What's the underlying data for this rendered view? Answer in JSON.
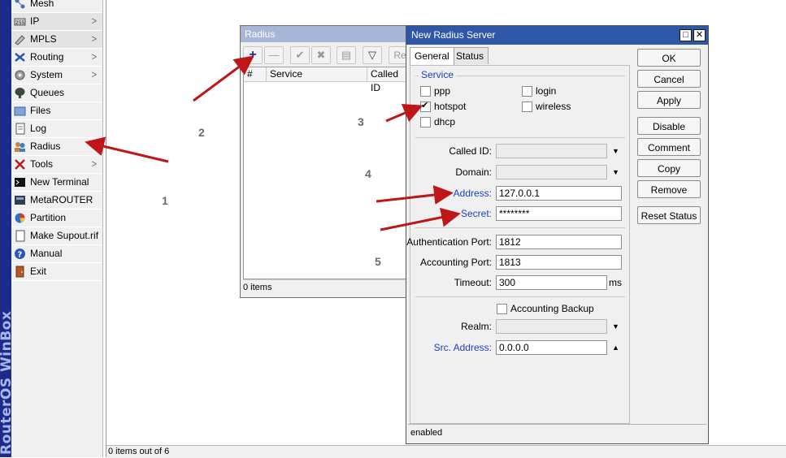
{
  "brand": {
    "text": "RouterOS WinBox"
  },
  "menu": {
    "items": [
      {
        "label": "Mesh",
        "icon": "mesh-icon",
        "arrow": false
      },
      {
        "label": "IP",
        "icon": "ip-icon",
        "arrow": true
      },
      {
        "label": "MPLS",
        "icon": "mpls-icon",
        "arrow": true
      },
      {
        "label": "Routing",
        "icon": "routing-icon",
        "arrow": true
      },
      {
        "label": "System",
        "icon": "gear-icon",
        "arrow": true
      },
      {
        "label": "Queues",
        "icon": "queues-icon",
        "arrow": false
      },
      {
        "label": "Files",
        "icon": "folder-icon",
        "arrow": false
      },
      {
        "label": "Log",
        "icon": "log-icon",
        "arrow": false
      },
      {
        "label": "Radius",
        "icon": "radius-users-icon",
        "arrow": false
      },
      {
        "label": "Tools",
        "icon": "tools-icon",
        "arrow": true
      },
      {
        "label": "New Terminal",
        "icon": "terminal-icon",
        "arrow": false
      },
      {
        "label": "MetaROUTER",
        "icon": "metarouter-icon",
        "arrow": false
      },
      {
        "label": "Partition",
        "icon": "pie-icon",
        "arrow": false
      },
      {
        "label": "Make Supout.rif",
        "icon": "document-icon",
        "arrow": false
      },
      {
        "label": "Manual",
        "icon": "help-icon",
        "arrow": false
      },
      {
        "label": "Exit",
        "icon": "exit-icon",
        "arrow": false
      }
    ],
    "arrow_glyph": "ᐳ"
  },
  "workspace": {
    "status": "0 items out of 6"
  },
  "radius_window": {
    "title": "Radius",
    "toolbar": {
      "add": "+",
      "remove": "—",
      "enable": "✔",
      "disable": "✖",
      "comment": "▤",
      "filter": "▽",
      "reset_partial": "Re"
    },
    "columns": [
      "#",
      "Service",
      "Called ID"
    ],
    "status": "0 items"
  },
  "dialog": {
    "title": "New Radius Server",
    "window_buttons": {
      "maximize": "□",
      "close": "✕"
    },
    "tabs": [
      "General",
      "Status"
    ],
    "service_section": {
      "title": "Service",
      "options": [
        {
          "label": "ppp",
          "checked": false
        },
        {
          "label": "login",
          "checked": false
        },
        {
          "label": "hotspot",
          "checked": true
        },
        {
          "label": "wireless",
          "checked": false
        },
        {
          "label": "dhcp",
          "checked": false
        }
      ]
    },
    "fields": {
      "called_id": {
        "label": "Called ID:",
        "value": ""
      },
      "domain": {
        "label": "Domain:",
        "value": ""
      },
      "address": {
        "label": "Address:",
        "value": "127.0.0.1"
      },
      "secret": {
        "label": "Secret:",
        "value": "********"
      },
      "auth_port": {
        "label": "Authentication Port:",
        "value": "1812"
      },
      "acct_port": {
        "label": "Accounting Port:",
        "value": "1813"
      },
      "timeout": {
        "label": "Timeout:",
        "value": "300",
        "unit": "ms"
      },
      "accounting_backup": {
        "label": "Accounting Backup",
        "checked": false
      },
      "realm": {
        "label": "Realm:",
        "value": ""
      },
      "src_address": {
        "label": "Src. Address:",
        "value": "0.0.0.0"
      }
    },
    "dropdown_glyph": "▼",
    "collapse_glyph": "▲",
    "buttons": [
      "OK",
      "Cancel",
      "Apply",
      "Disable",
      "Comment",
      "Copy",
      "Remove",
      "Reset Status"
    ],
    "status": "enabled"
  },
  "annotations": {
    "numbers": [
      "1",
      "2",
      "3",
      "4",
      "5"
    ],
    "arrow_color": "#c0161a"
  }
}
